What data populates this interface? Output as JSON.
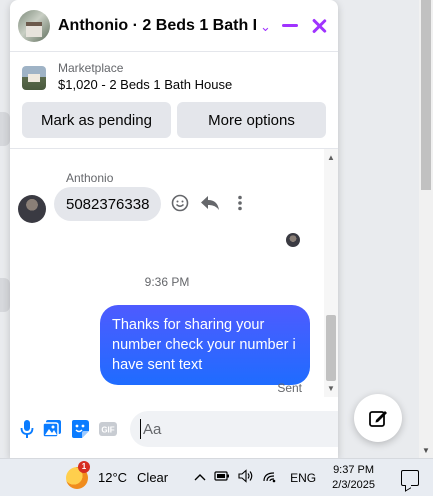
{
  "header": {
    "title": "Anthonio · 2 Beds 1 Bath H...",
    "chevron_icon": "chevron-down-icon",
    "minimize_icon": "minimize-icon",
    "close_icon": "close-icon",
    "accent_color": "#a033ff"
  },
  "listing": {
    "source": "Marketplace",
    "price_title": "$1,020 - 2 Beds 1 Bath House"
  },
  "actions": {
    "mark_pending": "Mark as pending",
    "more_options": "More options"
  },
  "messages": {
    "sender_name": "Anthonio",
    "incoming_text": "5082376338",
    "timestamp": "9:36 PM",
    "outgoing_text": "Thanks for sharing your number check your number i have sent text",
    "status": "Sent",
    "outgoing_color": "#1f6cff"
  },
  "composer": {
    "placeholder": "Aa",
    "icons": [
      "microphone-icon",
      "photo-icon",
      "sticker-icon",
      "gif-icon",
      "emoji-icon",
      "like-icon"
    ]
  },
  "taskbar": {
    "weather_badge": "1",
    "temperature": "12°C",
    "condition": "Clear",
    "language": "ENG",
    "time": "9:37 PM",
    "date": "2/3/2025"
  }
}
